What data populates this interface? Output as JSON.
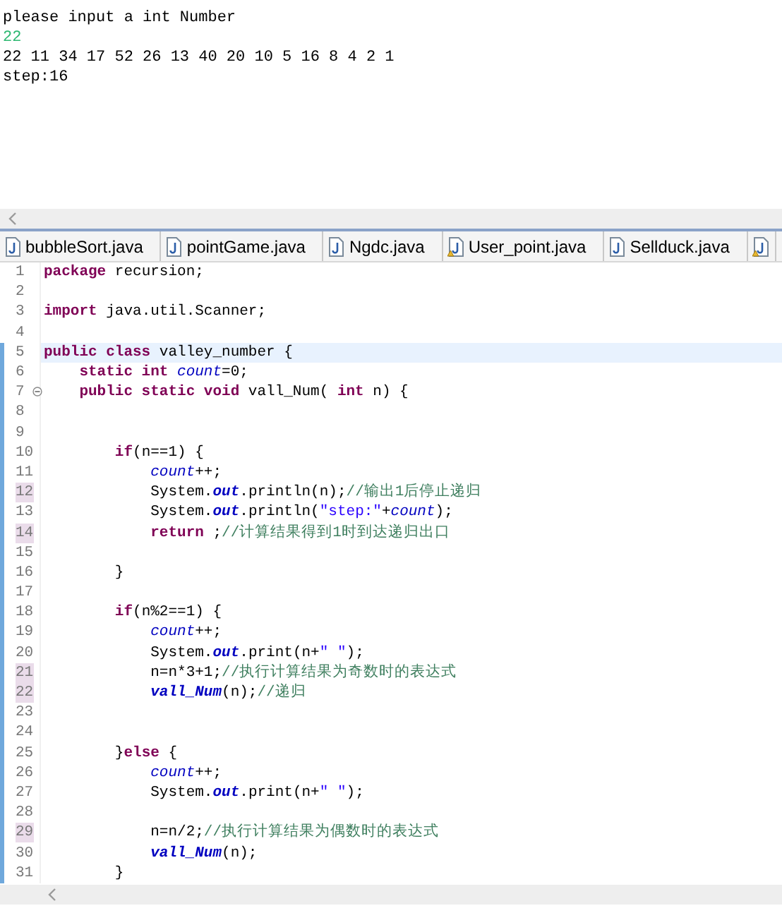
{
  "console": {
    "lines": [
      {
        "kind": "output",
        "text": "please input a int Number"
      },
      {
        "kind": "input",
        "text": "22"
      },
      {
        "kind": "output",
        "text": "22 11 34 17 52 26 13 40 20 10 5 16 8 4 2 1"
      },
      {
        "kind": "output",
        "text": "step:16"
      }
    ]
  },
  "tabs": [
    {
      "label": "bubbleSort.java",
      "warning": false
    },
    {
      "label": "pointGame.java",
      "warning": false
    },
    {
      "label": "Ngdc.java",
      "warning": false
    },
    {
      "label": "User_point.java",
      "warning": true
    },
    {
      "label": "Sellduck.java",
      "warning": false
    },
    {
      "warning": true
    }
  ],
  "editor": {
    "lines": [
      {
        "number": "1",
        "tokens": [
          {
            "kind": "keyword",
            "text": "package"
          },
          {
            "kind": "plain",
            "text": " recursion;"
          }
        ]
      },
      {
        "number": "2"
      },
      {
        "number": "3",
        "tokens": [
          {
            "kind": "keyword",
            "text": "import"
          },
          {
            "kind": "plain",
            "text": " java.util.Scanner;"
          }
        ]
      },
      {
        "number": "4"
      },
      {
        "number": "5",
        "current": true,
        "tokens": [
          {
            "kind": "keyword",
            "text": "public class"
          },
          {
            "kind": "plain",
            "text": " valley_number {"
          }
        ]
      },
      {
        "number": "6",
        "tokens": [
          {
            "kind": "keyword",
            "text": "    static int"
          },
          {
            "kind": "field",
            "text": " count"
          },
          {
            "kind": "plain",
            "text": "=0;"
          }
        ]
      },
      {
        "number": "7",
        "folded": true,
        "tokens": [
          {
            "kind": "keyword",
            "text": "    public static void"
          },
          {
            "kind": "plain",
            "text": " vall_Num( "
          },
          {
            "kind": "keyword",
            "text": "int"
          },
          {
            "kind": "plain",
            "text": " n) {"
          }
        ]
      },
      {
        "number": "8"
      },
      {
        "number": "9"
      },
      {
        "number": "10",
        "tokens": [
          {
            "kind": "keyword",
            "text": "        if"
          },
          {
            "kind": "plain",
            "text": "(n==1) {"
          }
        ]
      },
      {
        "number": "11",
        "tokens": [
          {
            "kind": "field",
            "text": "            count"
          },
          {
            "kind": "plain",
            "text": "++;"
          }
        ]
      },
      {
        "number": "12",
        "changed": true,
        "tokens": [
          {
            "kind": "plain",
            "text": "            System."
          },
          {
            "kind": "static",
            "text": "out"
          },
          {
            "kind": "plain",
            "text": ".println(n);"
          },
          {
            "kind": "comment",
            "text": "//输出1后停止递归"
          }
        ]
      },
      {
        "number": "13",
        "tokens": [
          {
            "kind": "plain",
            "text": "            System."
          },
          {
            "kind": "static",
            "text": "out"
          },
          {
            "kind": "plain",
            "text": ".println("
          },
          {
            "kind": "string",
            "text": "\"step:\""
          },
          {
            "kind": "plain",
            "text": "+"
          },
          {
            "kind": "field",
            "text": "count"
          },
          {
            "kind": "plain",
            "text": ");"
          }
        ]
      },
      {
        "number": "14",
        "changed": true,
        "tokens": [
          {
            "kind": "keyword",
            "text": "            return"
          },
          {
            "kind": "plain",
            "text": " ;"
          },
          {
            "kind": "comment",
            "text": "//计算结果得到1时到达递归出口"
          }
        ]
      },
      {
        "number": "15"
      },
      {
        "number": "16",
        "tokens": [
          {
            "kind": "plain",
            "text": "        }"
          }
        ]
      },
      {
        "number": "17"
      },
      {
        "number": "18",
        "tokens": [
          {
            "kind": "keyword",
            "text": "        if"
          },
          {
            "kind": "plain",
            "text": "(n%2==1) {"
          }
        ]
      },
      {
        "number": "19",
        "tokens": [
          {
            "kind": "field",
            "text": "            count"
          },
          {
            "kind": "plain",
            "text": "++;"
          }
        ]
      },
      {
        "number": "20",
        "tokens": [
          {
            "kind": "plain",
            "text": "            System."
          },
          {
            "kind": "static",
            "text": "out"
          },
          {
            "kind": "plain",
            "text": ".print(n+"
          },
          {
            "kind": "string",
            "text": "\" \""
          },
          {
            "kind": "plain",
            "text": ");"
          }
        ]
      },
      {
        "number": "21",
        "changed": true,
        "tokens": [
          {
            "kind": "plain",
            "text": "            n=n*3+1;"
          },
          {
            "kind": "comment",
            "text": "//执行计算结果为奇数时的表达式"
          }
        ]
      },
      {
        "number": "22",
        "changed": true,
        "tokens": [
          {
            "kind": "static",
            "text": "            vall_Num"
          },
          {
            "kind": "plain",
            "text": "(n);"
          },
          {
            "kind": "comment",
            "text": "//递归"
          }
        ]
      },
      {
        "number": "23"
      },
      {
        "number": "24"
      },
      {
        "number": "25",
        "tokens": [
          {
            "kind": "plain",
            "text": "        }"
          },
          {
            "kind": "keyword",
            "text": "else"
          },
          {
            "kind": "plain",
            "text": " {"
          }
        ]
      },
      {
        "number": "26",
        "tokens": [
          {
            "kind": "field",
            "text": "            count"
          },
          {
            "kind": "plain",
            "text": "++;"
          }
        ]
      },
      {
        "number": "27",
        "tokens": [
          {
            "kind": "plain",
            "text": "            System."
          },
          {
            "kind": "static",
            "text": "out"
          },
          {
            "kind": "plain",
            "text": ".print(n+"
          },
          {
            "kind": "string",
            "text": "\" \""
          },
          {
            "kind": "plain",
            "text": ");"
          }
        ]
      },
      {
        "number": "28"
      },
      {
        "number": "29",
        "changed": true,
        "tokens": [
          {
            "kind": "plain",
            "text": "            n=n/2;"
          },
          {
            "kind": "comment",
            "text": "//执行计算结果为偶数时的表达式"
          }
        ]
      },
      {
        "number": "30",
        "tokens": [
          {
            "kind": "static",
            "text": "            vall_Num"
          },
          {
            "kind": "plain",
            "text": "(n);"
          }
        ]
      },
      {
        "number": "31",
        "tokens": [
          {
            "kind": "plain",
            "text": "        }"
          }
        ]
      }
    ]
  }
}
